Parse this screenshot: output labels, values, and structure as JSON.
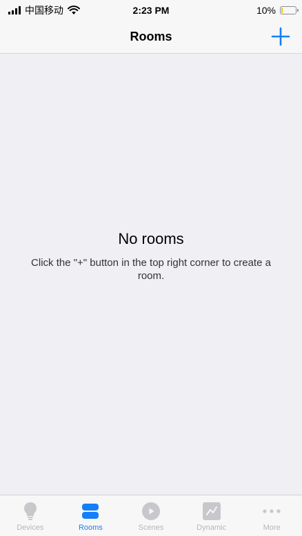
{
  "status_bar": {
    "carrier": "中国移动",
    "time": "2:23 PM",
    "battery_percent": "10%",
    "battery_level": 0.1,
    "battery_color": "#f5c400"
  },
  "nav": {
    "title": "Rooms",
    "add_icon": "plus-icon",
    "accent_color": "#157efb"
  },
  "empty_state": {
    "title": "No rooms",
    "description": "Click the \"+\" button in the top right corner to create a room."
  },
  "tab_bar": {
    "items": [
      {
        "label": "Devices",
        "icon": "lightbulb-icon",
        "active": false
      },
      {
        "label": "Rooms",
        "icon": "rooms-icon",
        "active": true
      },
      {
        "label": "Scenes",
        "icon": "play-circle-icon",
        "active": false
      },
      {
        "label": "Dynamic",
        "icon": "chart-icon",
        "active": false
      },
      {
        "label": "More",
        "icon": "more-dots-icon",
        "active": false
      }
    ]
  }
}
